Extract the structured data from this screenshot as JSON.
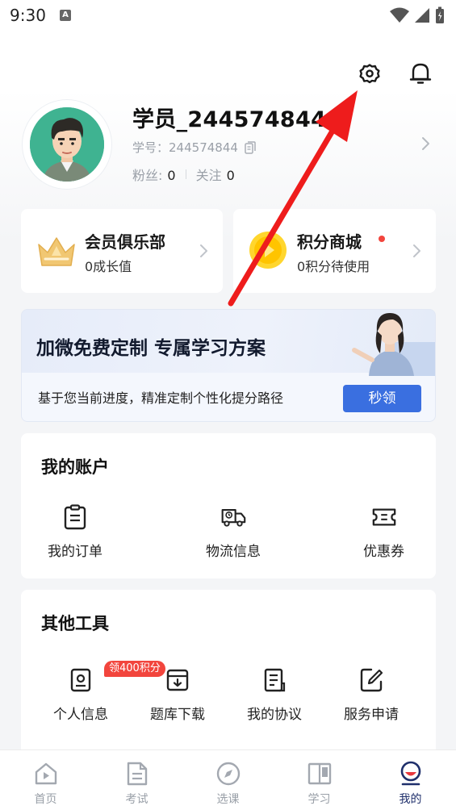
{
  "status_bar": {
    "time": "9:30",
    "notification_letter": "A"
  },
  "profile": {
    "name": "学员_244574844",
    "id_label": "学号：",
    "id_value": "244574844",
    "fans_label": "粉丝:",
    "fans_count": "0",
    "follow_label": "关注",
    "follow_count": "0"
  },
  "cards": {
    "club": {
      "title": "会员俱乐部",
      "subtitle": "0成长值"
    },
    "mall": {
      "title": "积分商城",
      "subtitle": "0积分待使用"
    }
  },
  "banner": {
    "title": "加微免费定制 专属学习方案",
    "subtitle": "基于您当前进度，精准定制个性化提分路径",
    "button": "秒领"
  },
  "account": {
    "title": "我的账户",
    "items": [
      {
        "label": "我的订单",
        "icon": "order-icon"
      },
      {
        "label": "物流信息",
        "icon": "delivery-truck-icon"
      },
      {
        "label": "优惠券",
        "icon": "coupon-icon"
      }
    ]
  },
  "tools": {
    "title": "其他工具",
    "badge": "领400积分",
    "items": [
      {
        "label": "个人信息",
        "icon": "personal-info-icon"
      },
      {
        "label": "题库下载",
        "icon": "download-box-icon"
      },
      {
        "label": "我的协议",
        "icon": "agreement-icon"
      },
      {
        "label": "服务申请",
        "icon": "service-request-icon"
      }
    ]
  },
  "tabbar": {
    "items": [
      {
        "label": "首页",
        "icon": "home-icon"
      },
      {
        "label": "考试",
        "icon": "exam-document-icon"
      },
      {
        "label": "选课",
        "icon": "compass-icon"
      },
      {
        "label": "学习",
        "icon": "book-icon"
      },
      {
        "label": "我的",
        "icon": "profile-icon"
      }
    ],
    "active": "我的"
  },
  "colors": {
    "accent_blue": "#3a6fe0",
    "badge_red": "#f2453d",
    "annotation_arrow": "#ee1c1c",
    "active_tab": "#1f2f6b"
  }
}
